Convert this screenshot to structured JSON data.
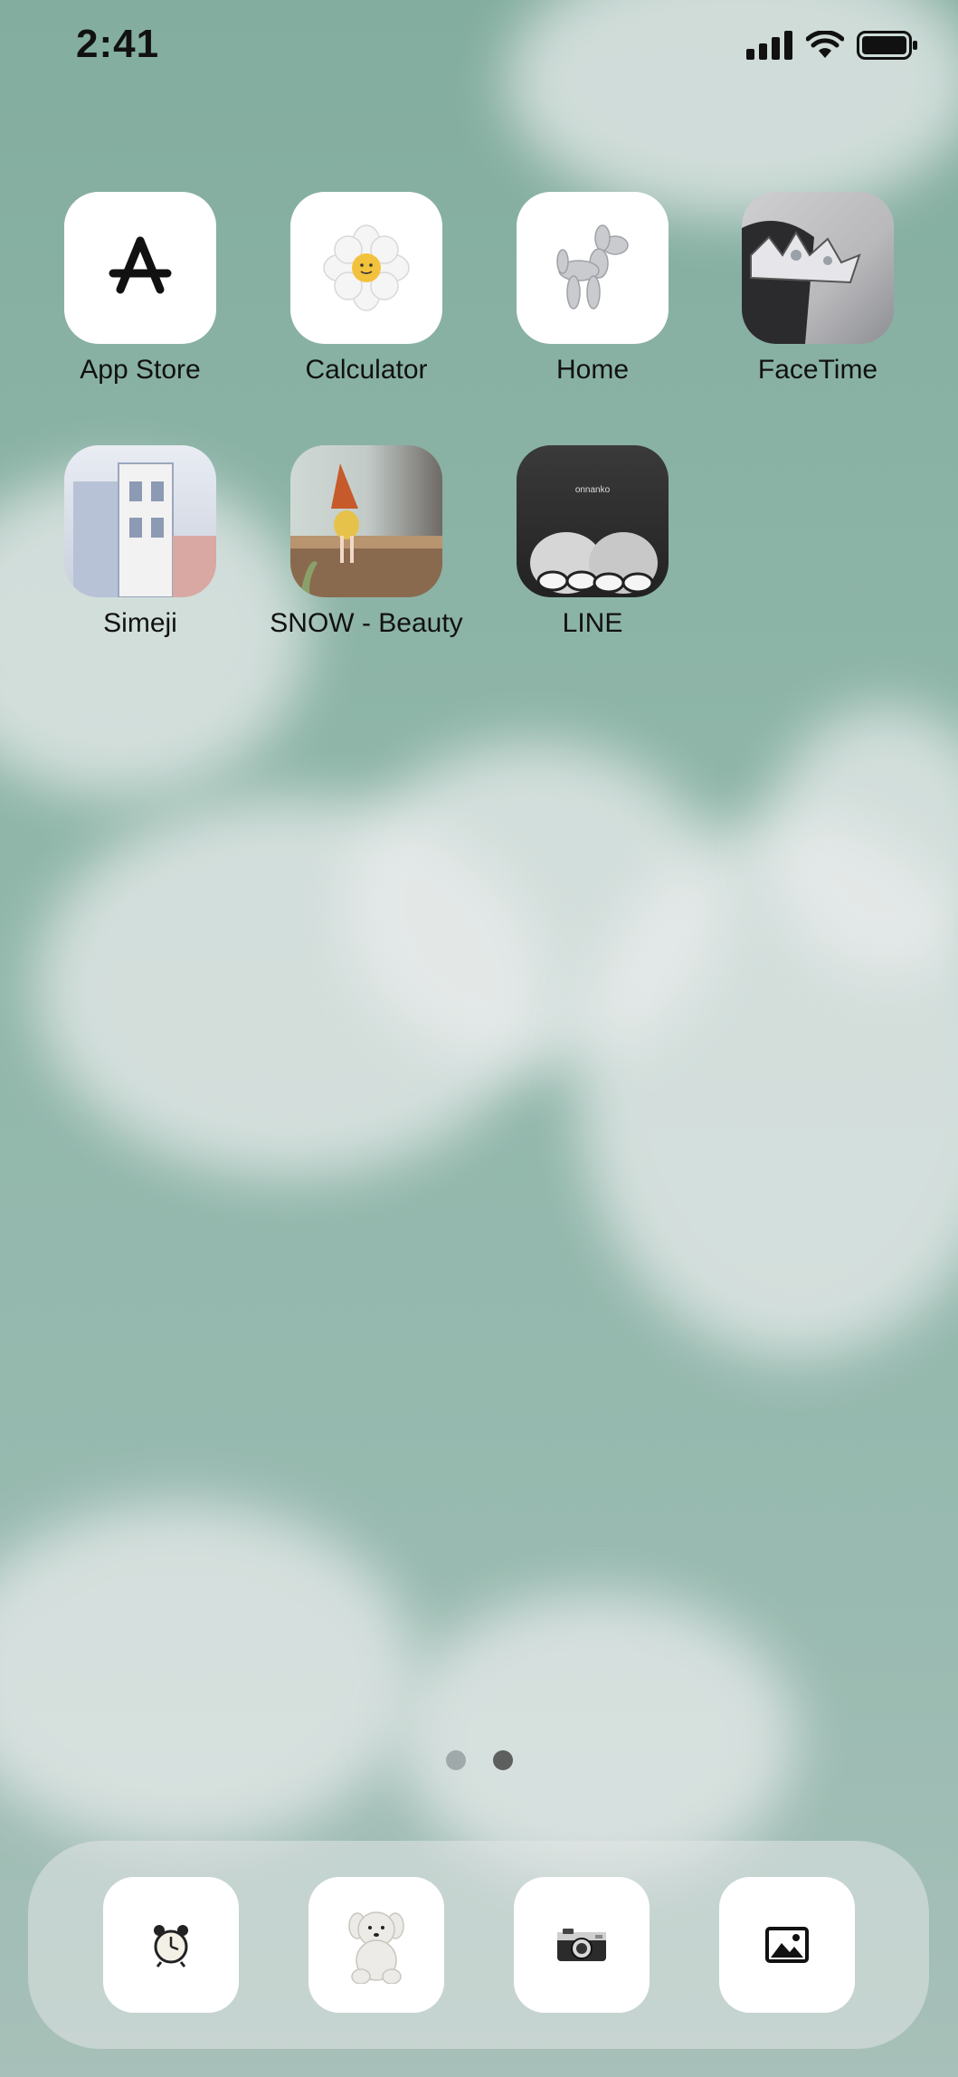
{
  "status": {
    "time": "2:41"
  },
  "home_grid": {
    "apps": [
      {
        "label": "App Store",
        "icon": "app-store-icon"
      },
      {
        "label": "Calculator",
        "icon": "daisy-icon"
      },
      {
        "label": "Home",
        "icon": "balloon-dog-icon"
      },
      {
        "label": "FaceTime",
        "icon": "tiara-photo-icon"
      },
      {
        "label": "Simeji",
        "icon": "building-photo-icon"
      },
      {
        "label": "SNOW - Beauty",
        "icon": "person-photo-icon"
      },
      {
        "label": "LINE",
        "icon": "bw-photo-icon"
      }
    ],
    "line_icon_caption": "onnanko"
  },
  "page_indicator": {
    "count": 2,
    "active": 2
  },
  "dock": {
    "items": [
      {
        "icon": "alarm-clock-icon"
      },
      {
        "icon": "teddy-bear-icon"
      },
      {
        "icon": "camera-icon"
      },
      {
        "icon": "photos-icon"
      }
    ]
  }
}
